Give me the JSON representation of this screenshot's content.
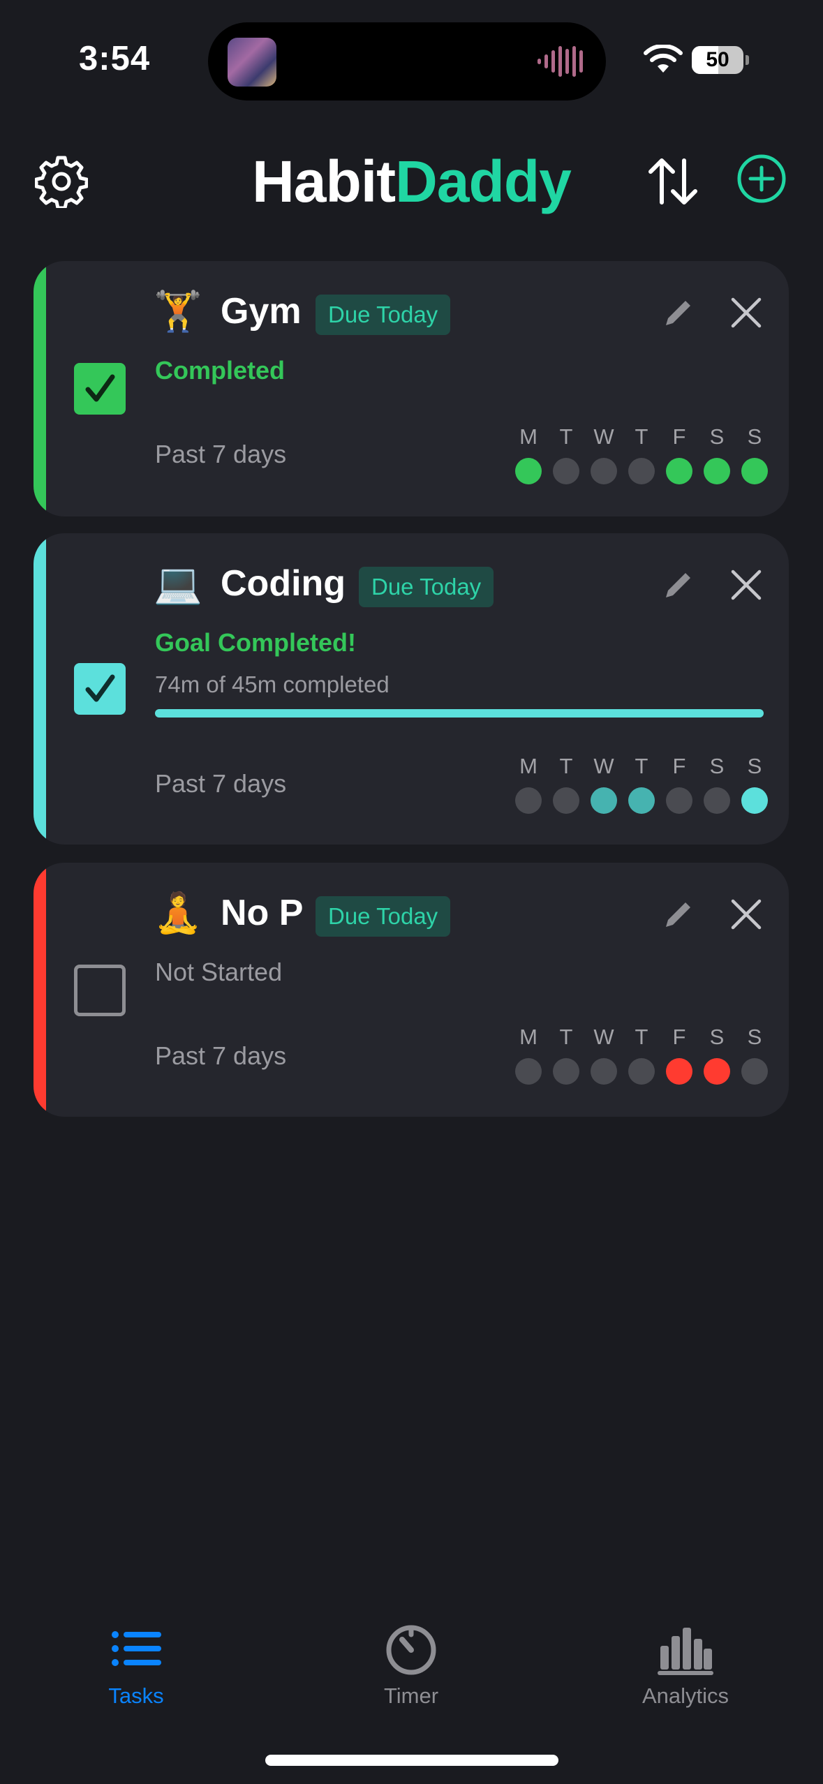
{
  "status_bar": {
    "time": "3:54",
    "battery": "50"
  },
  "header": {
    "title_part1": "Habit",
    "title_part2": "Daddy"
  },
  "week_days": [
    "M",
    "T",
    "W",
    "T",
    "F",
    "S",
    "S"
  ],
  "habits": [
    {
      "emoji": "🏋️",
      "name": "Gym",
      "badge": "Due Today",
      "status": "Completed",
      "completed": true,
      "accent": "#34c759",
      "past_label": "Past 7 days",
      "history": [
        true,
        false,
        false,
        false,
        true,
        true,
        true
      ]
    },
    {
      "emoji": "💻",
      "name": "Coding",
      "badge": "Due Today",
      "status": "Goal Completed!",
      "progress_text": "74m of 45m completed",
      "progress": 1.0,
      "completed": true,
      "accent": "#5ce0dc",
      "past_label": "Past 7 days",
      "history": [
        false,
        false,
        "partial",
        "partial",
        false,
        false,
        true
      ]
    },
    {
      "emoji": "🧘",
      "name": "No P",
      "badge": "Due Today",
      "status": "Not Started",
      "completed": false,
      "accent": "#ff3b30",
      "past_label": "Past 7 days",
      "history": [
        false,
        false,
        false,
        false,
        true,
        true,
        false
      ]
    }
  ],
  "tabs": [
    {
      "label": "Tasks",
      "icon": "list-icon",
      "active": true
    },
    {
      "label": "Timer",
      "icon": "timer-icon",
      "active": false
    },
    {
      "label": "Analytics",
      "icon": "bar-chart-icon",
      "active": false
    }
  ],
  "colors": {
    "brand": "#20d6a3",
    "active_tab": "#0a84ff",
    "inactive_tab": "#8e8e93",
    "dot_empty": "#4a4b51",
    "dot_partial": "#46b3b0"
  }
}
